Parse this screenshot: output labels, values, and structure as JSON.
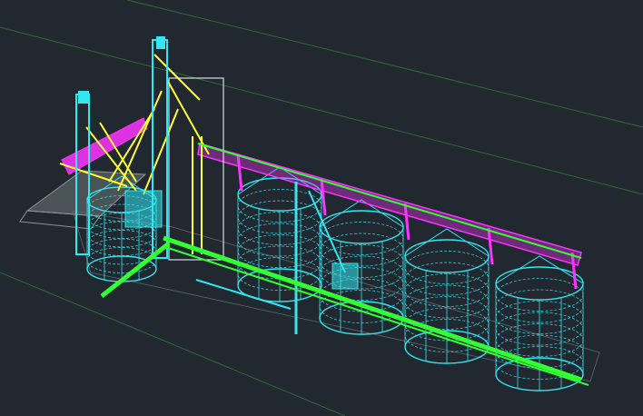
{
  "viewport": {
    "background": "#212830"
  },
  "palette": {
    "silo_wire": "#33e6f0",
    "gallery_truss": "#ff33ff",
    "elevator_frame": "#ffff33",
    "conveyor": "#33ff33",
    "ground_outline": "#6b7b83",
    "boundary_line": "#2f6a3a"
  },
  "scene": {
    "silo_count": 5,
    "silo_ring_rows": 9,
    "description_icon": "cad-wireframe-icon"
  }
}
